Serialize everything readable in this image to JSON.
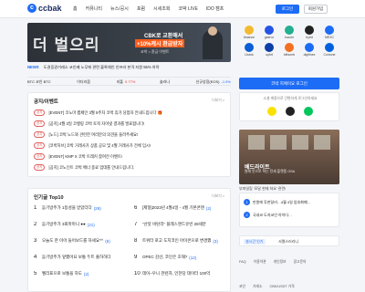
{
  "header": {
    "logo": "ccbak",
    "nav": [
      "홈",
      "커뮤니티",
      "뉴스/공시",
      "포럼",
      "시세조회",
      "코박 LIVE",
      "IDO 캠프"
    ],
    "login": "로그인",
    "join": "회원가입"
  },
  "banner": {
    "big": "더 벌으리",
    "line1": "CBK로 교환해서",
    "line2": "+10%캐시 환급받자",
    "line3": "코박 × 환급 이벤트"
  },
  "exchanges": [
    {
      "name": "binance",
      "color": "#f3ba2f"
    },
    {
      "name": "gate.io",
      "color": "#2354e6"
    },
    {
      "name": "kucoin",
      "color": "#23af91"
    },
    {
      "name": "bybit",
      "color": "#222222"
    },
    {
      "name": "MEXC",
      "color": "#1d6cf5"
    },
    {
      "name": "Lbank",
      "color": "#0b5ed7"
    },
    {
      "name": "upbit",
      "color": "#0c3fa8"
    },
    {
      "name": "bithumb",
      "color": "#f37021"
    },
    {
      "name": "digifinex",
      "color": "#1d6cf5"
    },
    {
      "name": "Coinone",
      "color": "#0061e0"
    }
  ],
  "ticker": {
    "label": "NEWS",
    "text": "도권증권거래소 코인베 노무에 관련 블록체인 인프라 본격 지원 55% 하락"
  },
  "coins": [
    {
      "name": "BTC 코인 BTC",
      "val": "",
      "cls": ""
    },
    {
      "name": "이더리움",
      "val": "",
      "cls": ""
    },
    {
      "name": "리플",
      "val": "0.77%",
      "cls": "up"
    },
    {
      "name": "솔라나",
      "val": "",
      "cls": ""
    },
    {
      "name": "신규상장(EOS)",
      "val": "-1.9%",
      "cls": "dn"
    }
  ],
  "notice": {
    "title": "공지/이벤트",
    "more": "더보기 >",
    "items": [
      {
        "badge": "공지",
        "text": "[EVENT] 코노마 캠페인 3월 5주차 코박 휴가 당첨자 안내드립니다 🎁"
      },
      {
        "badge": "공지",
        "text": "[공지] 4월 3일 코뱅링 코박 토픽 자이넷 결과를 발표합니다!"
      },
      {
        "badge": "공지",
        "text": "[노드] 코박 노드와 관련한 여러분의 의견을 들려주세요!"
      },
      {
        "badge": "공지",
        "text": "[코박허브] 코박 거래사가 상품 공모 및 4월 거래사가 전체 임시!"
      },
      {
        "badge": "공지",
        "text": "[EVENT] KMP X 코박 트레커 참여전 이벤트!"
      },
      {
        "badge": "공지",
        "text": "[공지] 코노인트 코박 배너 종료 업데를 안내드립니다."
      }
    ]
  },
  "top10": {
    "title": "인기글 Top10",
    "more": "더보기 >",
    "left": [
      {
        "n": "1",
        "t": "듣기방주가 1등성을 받았더다",
        "c": "(29)"
      },
      {
        "n": "2",
        "t": "듣기방주가 3회마마니 ●●",
        "c": "(21)"
      },
      {
        "n": "3",
        "t": "오늘도 한 이어 들어보드를 하세요^^",
        "c": "(9)"
      },
      {
        "n": "4",
        "t": "듣기방주가 앞했어요 보통 두트 출하하다",
        "c": ""
      },
      {
        "n": "5",
        "t": "벨리표으로 보통을 하도",
        "c": "(2)"
      }
    ],
    "right": [
      {
        "n": "6",
        "t": "[제형]2023년 4월4일 - 4월 기본콘텐",
        "c": "(2)"
      },
      {
        "n": "7",
        "t": "\"산뜻 비탄리\" 플레스엔드유빈 28세분",
        "c": ""
      },
      {
        "n": "8",
        "t": "트위터 로고 도지코인 아이콘으로 변경했",
        "c": "(3)"
      },
      {
        "n": "9",
        "t": "OPEC 감산, 코인은 호재?",
        "c": "(12)"
      },
      {
        "n": "10",
        "t": "데이–우니 관련자, 인한당 데이터 100억",
        "c": ""
      }
    ]
  },
  "right": {
    "cta": "코박 지에이요 로그인",
    "sub": "소셜 계정으로 간편하게 로그인하세요",
    "ad_title": "베드라이트",
    "ad_sub": "원래 뜻으로 하는 전세 플랫폼 OSA",
    "ad_caption": "부파일링 '모달 현재 쳐요' 관련!",
    "list": [
      {
        "n": "1",
        "t": "만원에 투판달러…4월 4일 암호화폐…"
      },
      {
        "n": "2",
        "t": "국내코 도지코인 아이다…"
      }
    ],
    "sel_a": "설시간 인기",
    "sel_b": "서켈스러라니",
    "links": [
      "FAQ",
      "이용약관",
      "개인정보",
      "광고문의"
    ],
    "foot": [
      "코인",
      "거래소",
      "CBK/USDT 가격"
    ]
  }
}
